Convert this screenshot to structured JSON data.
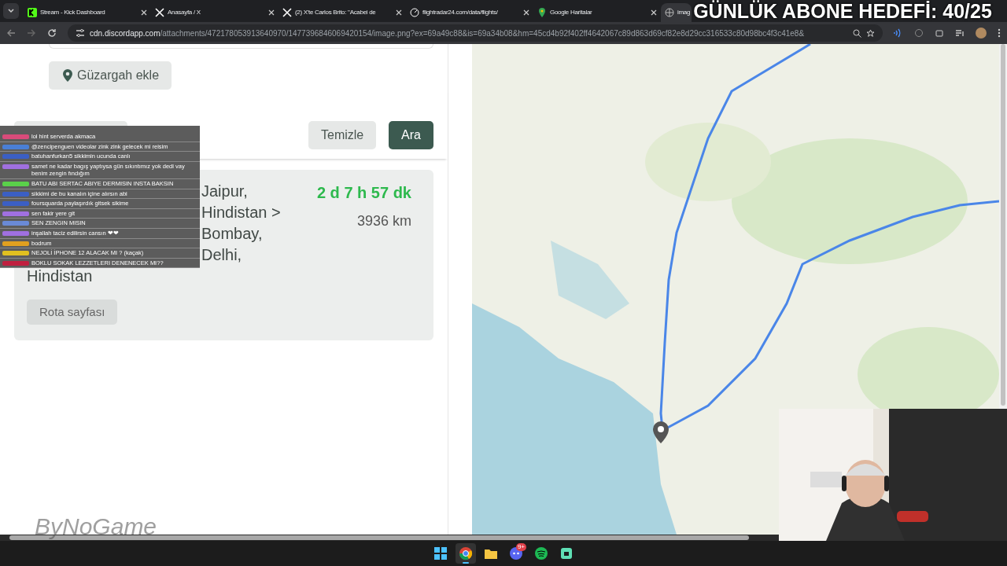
{
  "browser": {
    "tabs": [
      {
        "label": "Stream - Kick Dashboard",
        "selected": false
      },
      {
        "label": "Anasayfa / X",
        "selected": false
      },
      {
        "label": "(2) X'te Carlos Brito: \"Acabei de",
        "selected": false
      },
      {
        "label": "flightradar24.com/data/flights/",
        "selected": false
      },
      {
        "label": "Google Haritalar",
        "selected": false
      },
      {
        "label": "imag",
        "selected": true
      }
    ],
    "url_host": "cdn.discordapp.com",
    "url_path": "/attachments/472178053913640970/1477396846069420154/image.png?ex=69a49c88&is=69a34b08&hm=45cd4b92f402ff4642067c89d863d69cf82e8d29cc316533c80d98bc4f3c41e8&"
  },
  "panel": {
    "add_waypoint": "Güzargah ekle",
    "clear": "Temizle",
    "search": "Ara",
    "result": {
      "route_lines": [
        "Jaipur,",
        "Hindistan >",
        "Bombay,",
        "Delhi,",
        "Hindistan"
      ],
      "duration": "2 d 7 h 57 dk",
      "distance": "3936 km",
      "route_page": "Rota sayfası"
    }
  },
  "overlay": {
    "goal": "GÜNLÜK ABONE HEDEFİ: 40/25",
    "logo": "ByNoGame",
    "chat": [
      {
        "color": "#d94b7a",
        "text": "lol hint serverda akmaca"
      },
      {
        "color": "#4a7fd6",
        "text": "@zencipenguen videolar zink zink gelecek mi reisim"
      },
      {
        "color": "#3b5fc4",
        "text": "batuhanfurkan5 sikkimin ucunda canlı"
      },
      {
        "color": "#a070e0",
        "text": "samet ne kadar bagış yaptıysa gün sıkıntımız yok dedi vay benim zengin fındığım"
      },
      {
        "color": "#5ad04a",
        "text": "BATU ABI SERTAC ABIYE DERMISIN INSTA BAKSIN"
      },
      {
        "color": "#3b5fc4",
        "text": "sikkimi de bu kanalın içine alırsın abi"
      },
      {
        "color": "#3b5fc4",
        "text": "foursquarda paylaşırdık gitsek sikime"
      },
      {
        "color": "#a070e0",
        "text": "sen fakir yere git"
      },
      {
        "color": "#6a8ad6",
        "text": "SEN ZENGIN MISIN"
      },
      {
        "color": "#a070e0",
        "text": "inşallah taciz edilirsin cansın ❤❤"
      },
      {
        "color": "#e0a020",
        "text": "bodrum"
      },
      {
        "color": "#e0c020",
        "text": "NEJOLİ İPHONE 12 ALACAK MI ? (kaçak)"
      },
      {
        "color": "#c02040",
        "text": "BOKLU SOKAK LEZZETLERI DENENECEK MI??"
      }
    ]
  },
  "taskbar": {
    "apps": [
      {
        "selected": false
      },
      {
        "selected": true
      },
      {
        "selected": false
      },
      {
        "selected": false,
        "badge": "9+"
      },
      {
        "selected": false
      },
      {
        "selected": false
      }
    ]
  }
}
